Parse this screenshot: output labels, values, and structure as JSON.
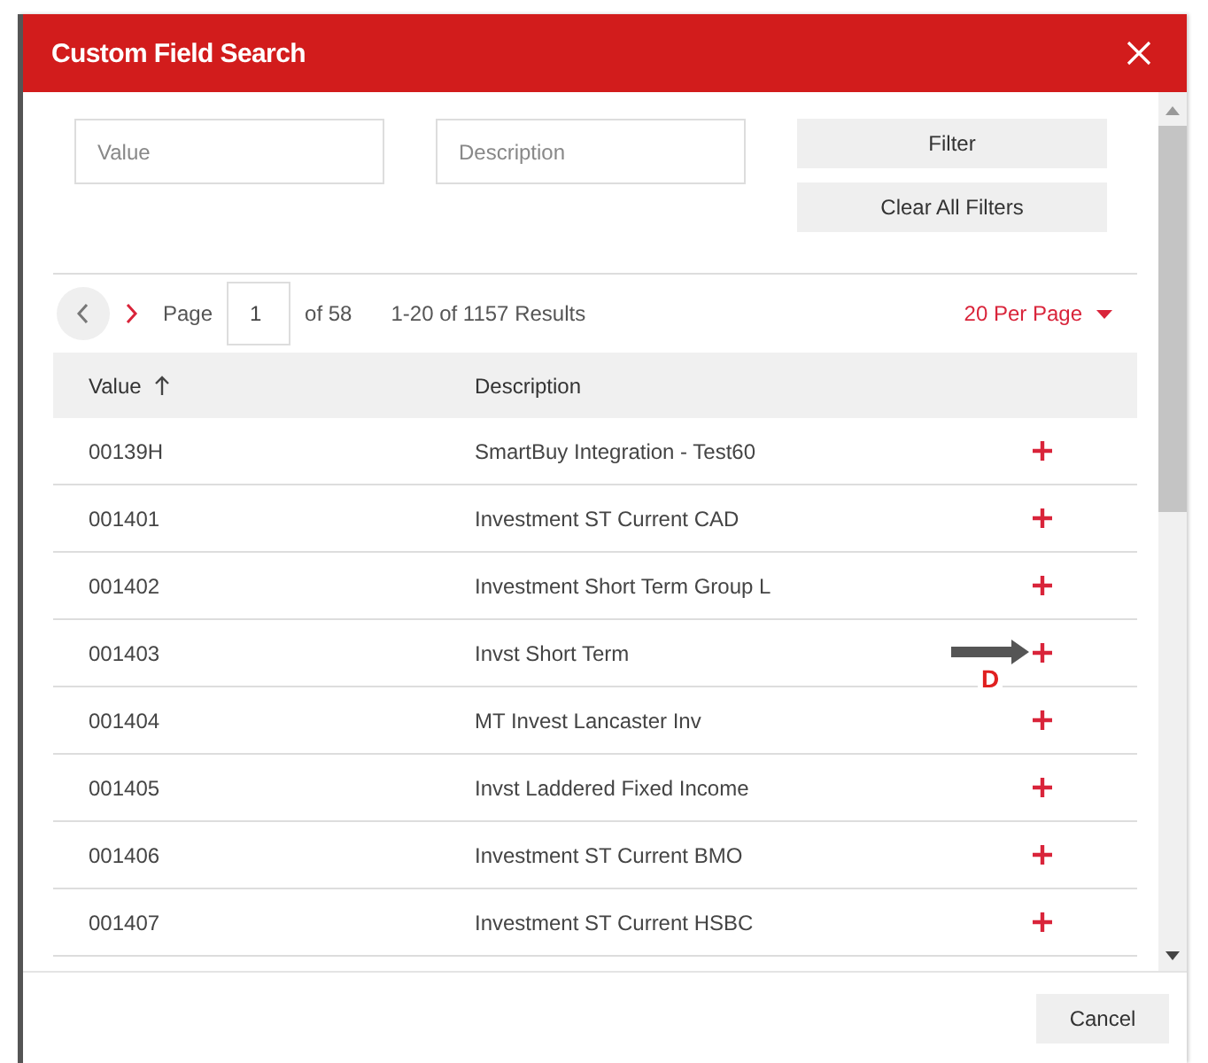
{
  "dialog": {
    "title": "Custom Field Search"
  },
  "filters": {
    "fields": [
      {
        "placeholder": "Value"
      },
      {
        "placeholder": "Description"
      }
    ],
    "buttons": [
      "Filter",
      "Clear All Filters"
    ]
  },
  "pagination": {
    "prev": {
      "disabled": true
    },
    "next": {
      "disabled": false
    },
    "page_label": "Page",
    "page": "1",
    "page_count": "of 58",
    "results": "1-20 of 1157 Results",
    "per_page": "20 Per Page"
  },
  "table": {
    "columns": [
      {
        "label": "Value",
        "sorted": true
      },
      {
        "label": "Description",
        "sorted": false
      }
    ],
    "rows": [
      {
        "value": "00139H",
        "description": "SmartBuy Integration - Test60"
      },
      {
        "value": "001401",
        "description": "Investment ST Current CAD"
      },
      {
        "value": "001402",
        "description": "Investment Short Term Group L"
      },
      {
        "value": "001403",
        "description": "Invst Short Term",
        "annotation": "D"
      },
      {
        "value": "001404",
        "description": "MT Invest Lancaster Inv"
      },
      {
        "value": "001405",
        "description": "Invst Laddered Fixed Income"
      },
      {
        "value": "001406",
        "description": "Investment ST Current BMO"
      },
      {
        "value": "001407",
        "description": "Investment ST Current HSBC"
      }
    ]
  },
  "footer": {
    "buttons": [
      "Cancel"
    ]
  }
}
